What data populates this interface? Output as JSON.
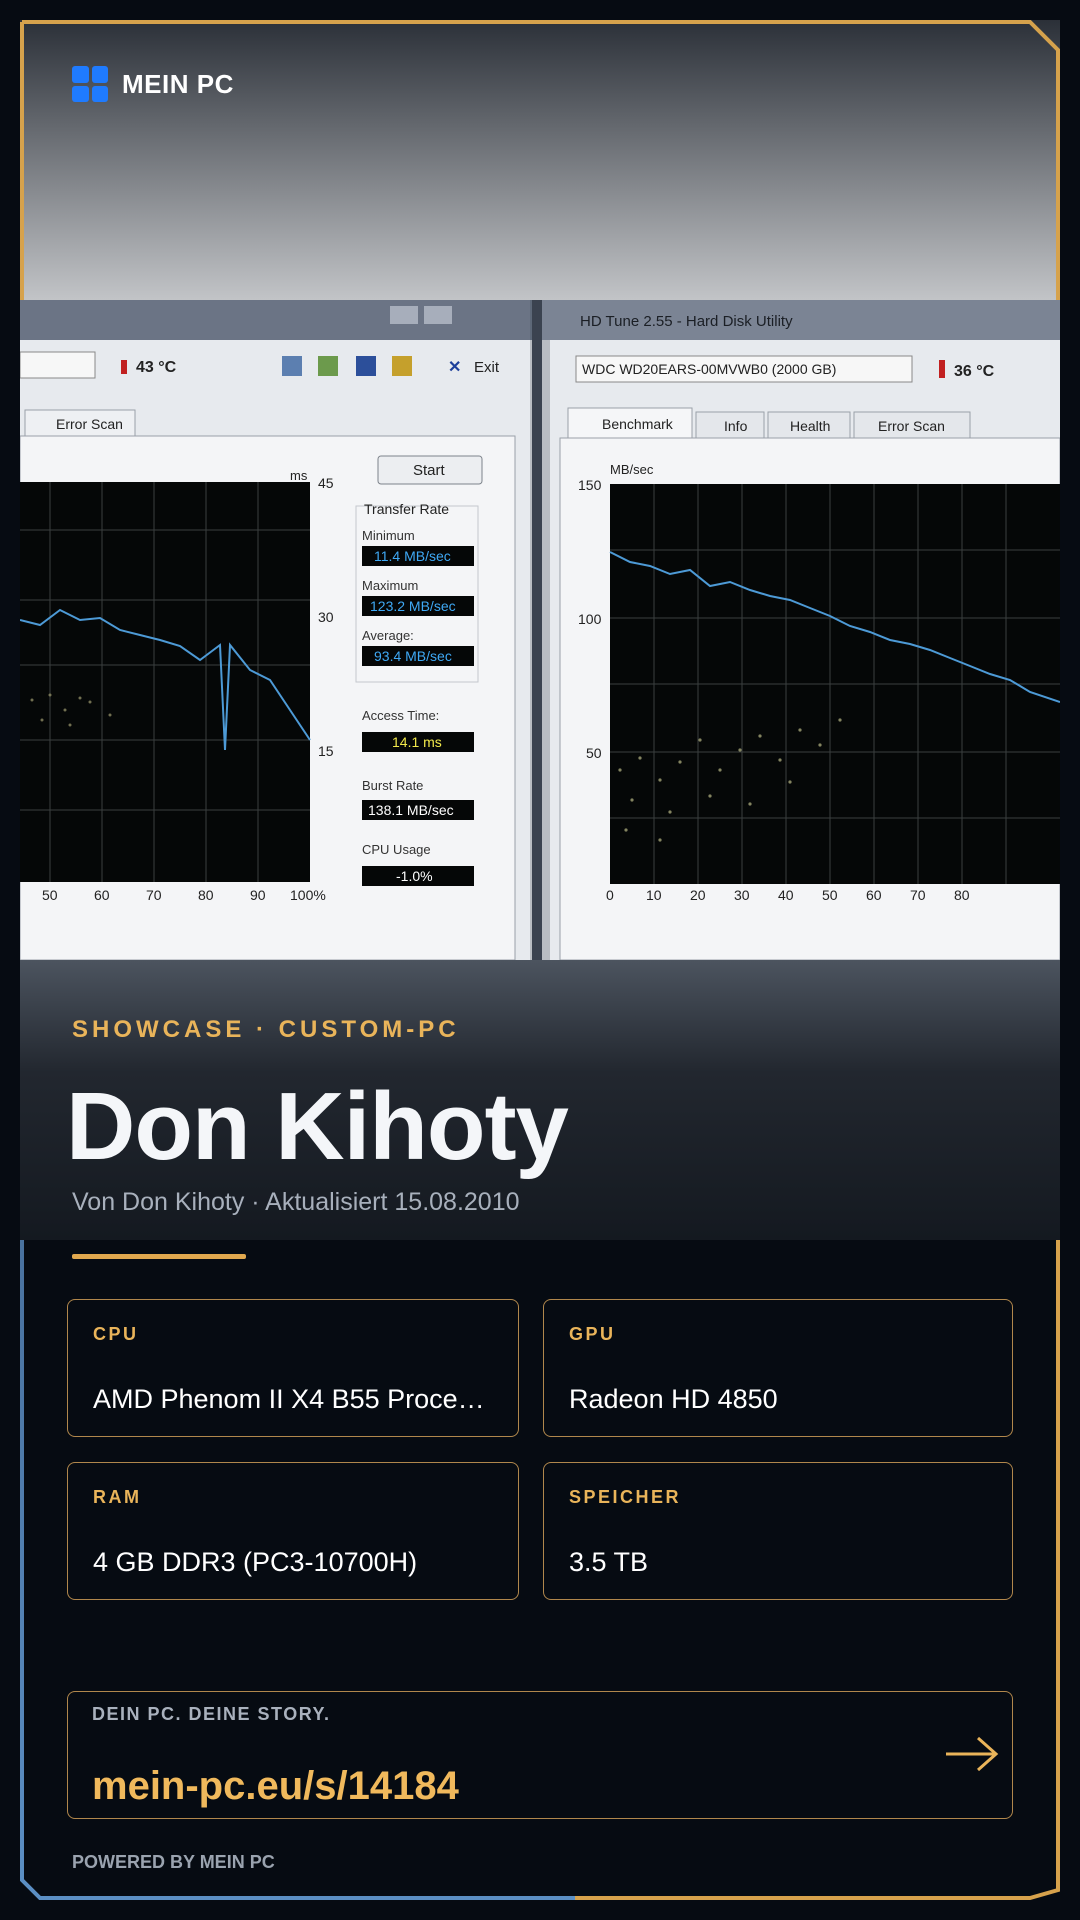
{
  "brand": {
    "name": "MEIN PC",
    "logo_icon": "windows-logo-icon",
    "logo_color": "#1f7bff"
  },
  "hero_screenshot": {
    "left_window": {
      "temperature": "43 °C",
      "exit_label": "Exit",
      "tab_error_scan": "Error Scan",
      "start_button": "Start",
      "unit_ms": "ms",
      "ms_ticks": [
        "45",
        "30",
        "15"
      ],
      "transfer_rate": "Transfer Rate",
      "minimum_label": "Minimum",
      "minimum_value": "11.4 MB/sec",
      "maximum_label": "Maximum",
      "maximum_value": "123.2 MB/sec",
      "average_label": "Average:",
      "average_value": "93.4 MB/sec",
      "access_time_label": "Access Time:",
      "access_time_value": "14.1 ms",
      "burst_rate_label": "Burst Rate",
      "burst_rate_value": "138.1 MB/sec",
      "cpu_usage_label": "CPU Usage",
      "cpu_usage_value": "-1.0%",
      "x_ticks": [
        "50",
        "60",
        "70",
        "80",
        "90",
        "100%"
      ]
    },
    "right_window": {
      "title": "HD Tune 2.55 - Hard Disk Utility",
      "drive": "WDC WD20EARS-00MVWB0 (2000 GB)",
      "temperature": "36 °C",
      "tabs": [
        "Benchmark",
        "Info",
        "Health",
        "Error Scan"
      ],
      "unit_mbsec": "MB/sec",
      "y_ticks": [
        "150",
        "100",
        "50"
      ],
      "x_ticks": [
        "0",
        "10",
        "20",
        "30",
        "40",
        "50",
        "60",
        "70",
        "80"
      ]
    }
  },
  "kicker": "SHOWCASE · CUSTOM-PC",
  "title": "Don Kihoty",
  "subtitle": "Von Don Kihoty · Aktualisiert 15.08.2010",
  "specs": [
    {
      "label": "CPU",
      "value": "AMD Phenom II X4 B55 Process..."
    },
    {
      "label": "GPU",
      "value": "Radeon HD 4850"
    },
    {
      "label": "RAM",
      "value": "4 GB DDR3 (PC3-10700H)"
    },
    {
      "label": "SPEICHER",
      "value": "3.5 TB"
    }
  ],
  "cta": {
    "tagline": "DEIN PC. DEINE STORY.",
    "url": "mein-pc.eu/s/14184",
    "arrow_icon": "arrow-right-icon"
  },
  "powered_by": "POWERED BY MEIN PC",
  "colors": {
    "accent": "#e9b45a",
    "frame_gold": "#d6a24c",
    "frame_blue": "#5b8fc4",
    "background": "#060b12"
  }
}
